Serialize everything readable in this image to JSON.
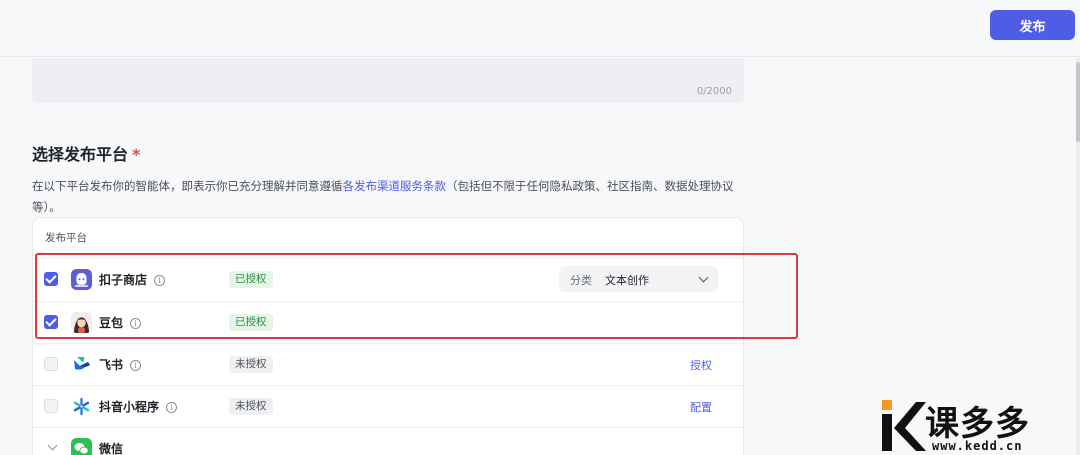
{
  "header": {
    "publish_label": "发布"
  },
  "description": {
    "counter": "0/2000"
  },
  "section": {
    "title": "选择发布平台",
    "required_mark": "*",
    "notice_before": "在以下平台发布你的智能体，即表示你已充分理解并同意遵循",
    "notice_link": "各发布渠道服务条款",
    "notice_after": "（包括但不限于任何隐私政策、社区指南、数据处理协议等）。"
  },
  "panel": {
    "header": "发布平台",
    "rows": [
      {
        "name": "扣子商店",
        "checked": true,
        "status": "已授权",
        "category_label": "分类",
        "category_value": "文本创作"
      },
      {
        "name": "豆包",
        "checked": true,
        "status": "已授权"
      },
      {
        "name": "飞书",
        "checked": false,
        "status": "未授权",
        "action": "授权"
      },
      {
        "name": "抖音小程序",
        "checked": false,
        "status": "未授权",
        "action": "配置"
      },
      {
        "name": "微信"
      }
    ]
  },
  "watermark": {
    "brand": "课多多",
    "url": "www.kedd.cn"
  },
  "colors": {
    "accent": "#4e5ce6",
    "highlight": "#d83c3c",
    "authorized": "#2e8b45"
  }
}
